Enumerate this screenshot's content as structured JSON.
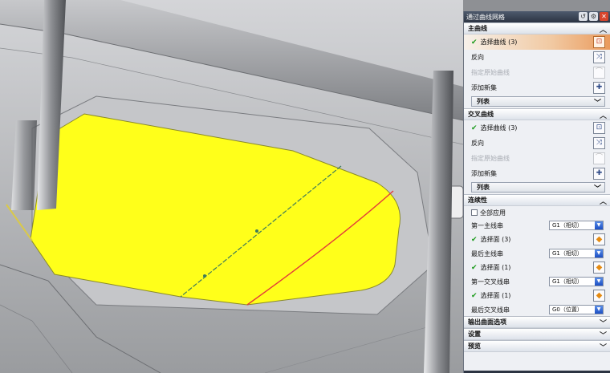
{
  "dialog": {
    "title": "通过曲线网格",
    "primary": {
      "header": "主曲线",
      "select_curve": "选择曲线 (3)",
      "reverse": "反向",
      "specify_origin": "指定原始曲线",
      "add_new_set": "添加新集",
      "list": "列表"
    },
    "cross": {
      "header": "交叉曲线",
      "select_curve": "选择曲线 (3)",
      "reverse": "反向",
      "specify_origin": "指定原始曲线",
      "add_new_set": "添加新集",
      "list": "列表"
    },
    "continuity": {
      "header": "连续性",
      "apply_all": "全部应用",
      "first_primary": "第一主线串",
      "first_primary_value": "G1（相切）",
      "sel_face_1": "选择面 (3)",
      "last_primary": "最后主线串",
      "last_primary_value": "G1（相切）",
      "sel_face_2": "选择面 (1)",
      "first_cross": "第一交叉线串",
      "first_cross_value": "G1（相切）",
      "sel_face_3": "选择面 (1)",
      "last_cross": "最后交叉线串",
      "last_cross_value": "G0（位置）"
    },
    "output_options": "输出曲面选项",
    "settings": "设置",
    "preview": "预览"
  },
  "colors": {
    "surface_fill": "#ffff1a",
    "part_gray": "#b9bbbe",
    "title_bar": "#2c3442",
    "check": "#1b9a1b",
    "selected_row": "#ea9a5c"
  },
  "icons": [
    "gear-icon",
    "close-icon",
    "reset-icon",
    "select-curve-icon",
    "reverse-icon",
    "origin-curve-icon",
    "add-set-icon",
    "select-face-icon",
    "chevron-down-icon"
  ]
}
